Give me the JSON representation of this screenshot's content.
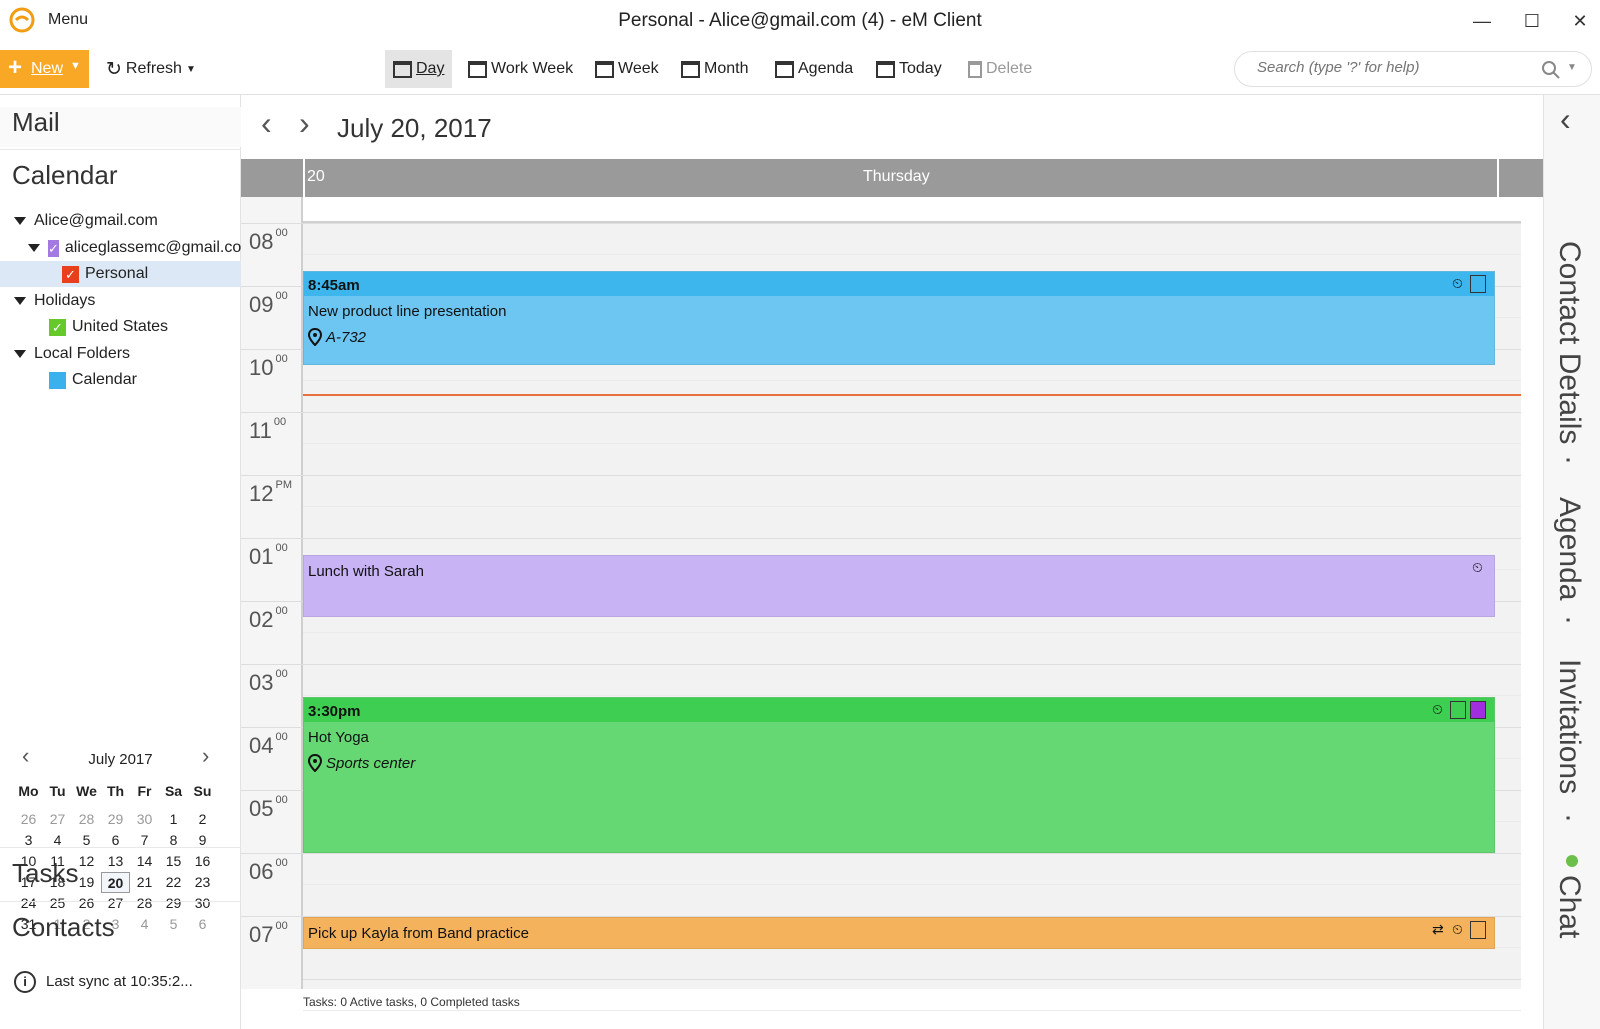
{
  "window": {
    "title": "Personal - Alice@gmail.com (4) - eM Client",
    "menu_label": "Menu",
    "minimize": "—",
    "maximize": "☐",
    "close": "✕"
  },
  "toolbar": {
    "new_label": "New",
    "refresh_label": "Refresh",
    "views": [
      {
        "label": "Day",
        "icon": "day-calendar-icon"
      },
      {
        "label": "Work Week",
        "icon": "workweek-calendar-icon"
      },
      {
        "label": "Week",
        "icon": "week-calendar-icon"
      },
      {
        "label": "Month",
        "icon": "month-calendar-icon"
      },
      {
        "label": "Agenda",
        "icon": "agenda-icon"
      },
      {
        "label": "Today",
        "icon": "today-icon"
      },
      {
        "label": "Delete",
        "icon": "trash-icon"
      }
    ],
    "search_placeholder": "Search (type '?' for help)"
  },
  "sidebar": {
    "mail": "Mail",
    "calendar": "Calendar",
    "tree": {
      "account": "Alice@gmail.com",
      "subaccount": "aliceglassemc@gmail.com",
      "personal": "Personal",
      "holidays": "Holidays",
      "united_states": "United States",
      "local_folders": "Local Folders",
      "local_calendar": "Calendar"
    },
    "tasks": "Tasks",
    "contacts": "Contacts",
    "sync": "Last sync at 10:35:2..."
  },
  "minical": {
    "month": "July 2017",
    "weekdays": [
      "Mo",
      "Tu",
      "We",
      "Th",
      "Fr",
      "Sa",
      "Su"
    ],
    "weeks": [
      [
        "26",
        "27",
        "28",
        "29",
        "30",
        "1",
        "2"
      ],
      [
        "3",
        "4",
        "5",
        "6",
        "7",
        "8",
        "9"
      ],
      [
        "10",
        "11",
        "12",
        "13",
        "14",
        "15",
        "16"
      ],
      [
        "17",
        "18",
        "19",
        "20",
        "21",
        "22",
        "23"
      ],
      [
        "24",
        "25",
        "26",
        "27",
        "28",
        "29",
        "30"
      ],
      [
        "31",
        "1",
        "2",
        "3",
        "4",
        "5",
        "6"
      ]
    ],
    "today": "20"
  },
  "main": {
    "date": "July 20, 2017",
    "day_number": "20",
    "day_name": "Thursday",
    "hours": [
      {
        "h": "08",
        "m": "00"
      },
      {
        "h": "09",
        "m": "00"
      },
      {
        "h": "10",
        "m": "00"
      },
      {
        "h": "11",
        "m": "00"
      },
      {
        "h": "12",
        "m": "PM"
      },
      {
        "h": "01",
        "m": "00"
      },
      {
        "h": "02",
        "m": "00"
      },
      {
        "h": "03",
        "m": "00"
      },
      {
        "h": "04",
        "m": "00"
      },
      {
        "h": "05",
        "m": "00"
      },
      {
        "h": "06",
        "m": "00"
      },
      {
        "h": "07",
        "m": "00"
      }
    ],
    "events": [
      {
        "time": "8:45am",
        "title": "New product line presentation",
        "location": "A-732",
        "bar_color": "#3db6ee",
        "body_color": "#6cc6f1"
      },
      {
        "time": "",
        "title": "Lunch with Sarah",
        "location": "",
        "bar_color": "#c8b3f5",
        "body_color": "#c8b3f5"
      },
      {
        "time": "3:30pm",
        "title": "Hot Yoga",
        "location": "Sports center",
        "bar_color": "#3dce52",
        "body_color": "#66d873"
      },
      {
        "time": "",
        "title": "Pick up Kayla from Band practice",
        "location": "",
        "bar_color": "#f4b25c",
        "body_color": "#f4b25c"
      }
    ],
    "status": "Tasks: 0 Active tasks, 0 Completed tasks"
  },
  "rightpanel": {
    "contact_details": "Contact Details",
    "agenda": "Agenda",
    "invitations": "Invitations",
    "chat": "Chat",
    "dot": "·"
  },
  "colors": {
    "accent": "#f9a825",
    "header_grey": "#9a9a9a",
    "now_line": "#e8703a",
    "chat_online": "#6cc04a"
  }
}
